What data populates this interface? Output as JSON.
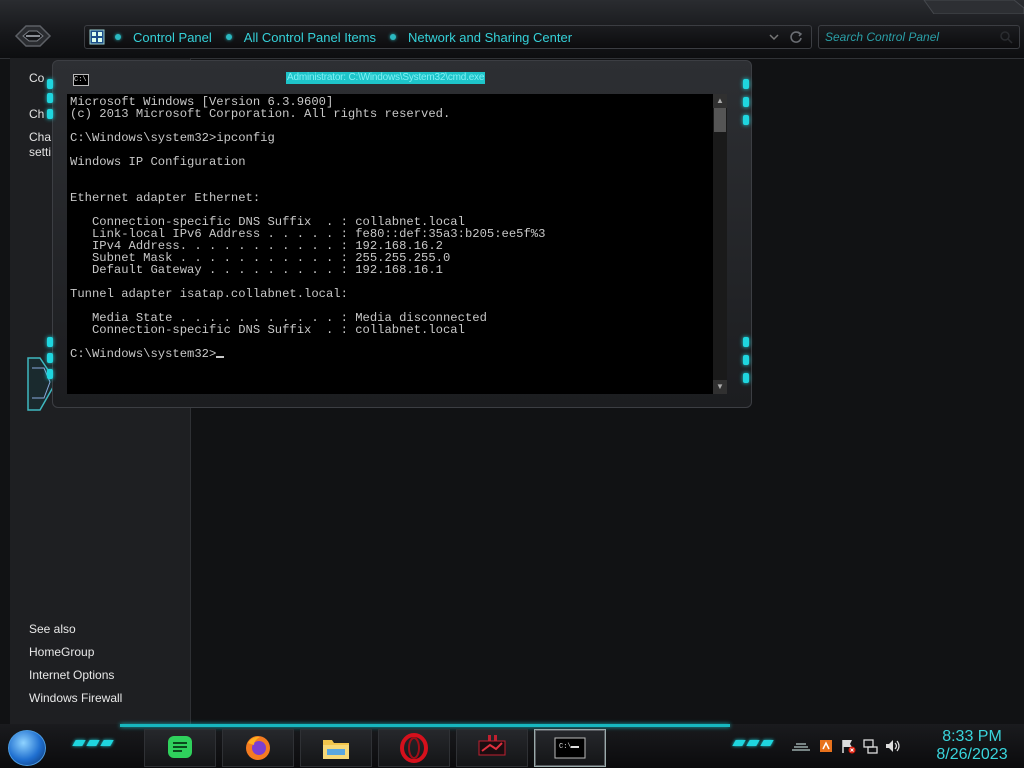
{
  "explorer": {
    "breadcrumbs": [
      "Control Panel",
      "All Control Panel Items",
      "Network and Sharing Center"
    ],
    "search_placeholder": "Search Control Panel"
  },
  "left_pane": {
    "tasks_partial": [
      "Co",
      "Ch",
      "Cha",
      "setti"
    ],
    "see_also_heading": "See also",
    "see_also_links": [
      "HomeGroup",
      "Internet Options",
      "Windows Firewall"
    ]
  },
  "console": {
    "title": "Administrator: C:\\Windows\\System32\\cmd.exe",
    "app_icon_text": "C:\\",
    "output": "Microsoft Windows [Version 6.3.9600]\n(c) 2013 Microsoft Corporation. All rights reserved.\n\nC:\\Windows\\system32>ipconfig\n\nWindows IP Configuration\n\n\nEthernet adapter Ethernet:\n\n   Connection-specific DNS Suffix  . : collabnet.local\n   Link-local IPv6 Address . . . . . : fe80::def:35a3:b205:ee5f%3\n   IPv4 Address. . . . . . . . . . . : 192.168.16.2\n   Subnet Mask . . . . . . . . . . . : 255.255.255.0\n   Default Gateway . . . . . . . . . : 192.168.16.1\n\nTunnel adapter isatap.collabnet.local:\n\n   Media State . . . . . . . . . . . : Media disconnected\n   Connection-specific DNS Suffix  . : collabnet.local\n\nC:\\Windows\\system32>"
  },
  "taskbar": {
    "pinned": [
      {
        "name": "messaging-app",
        "icon": "chat-bubble-icon"
      },
      {
        "name": "firefox",
        "icon": "firefox-icon"
      },
      {
        "name": "file-explorer",
        "icon": "folder-icon"
      },
      {
        "name": "opera",
        "icon": "opera-icon"
      },
      {
        "name": "app",
        "icon": "red-app-icon"
      },
      {
        "name": "command-prompt",
        "icon": "cmd-icon",
        "active": true
      }
    ],
    "tray_icons": [
      "notification-icon",
      "action-center-flag-icon",
      "network-icon",
      "volume-icon"
    ],
    "time": "8:33 PM",
    "date": "8/26/2023"
  },
  "colors": {
    "accent": "#1fd6df",
    "breadcrumb_text": "#35d1d9",
    "console_bg": "#000000",
    "console_text": "#c8c8c8"
  }
}
